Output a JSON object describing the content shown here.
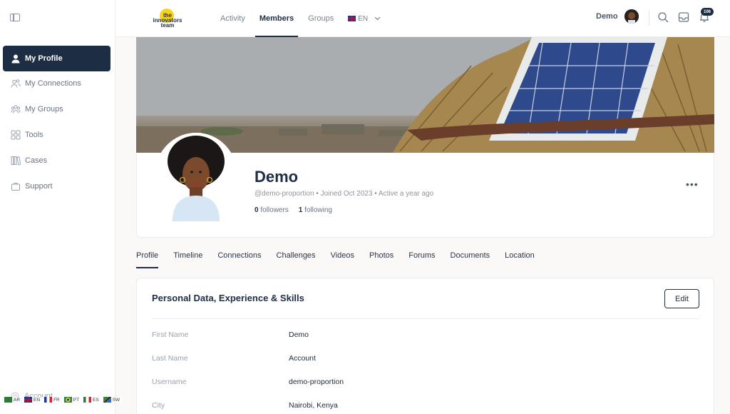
{
  "sidebar": {
    "items": [
      {
        "label": "My Profile",
        "icon": "user-icon"
      },
      {
        "label": "My Connections",
        "icon": "connections-icon"
      },
      {
        "label": "My Groups",
        "icon": "groups-icon"
      },
      {
        "label": "Tools",
        "icon": "tools-icon"
      },
      {
        "label": "Cases",
        "icon": "cases-icon"
      },
      {
        "label": "Support",
        "icon": "support-icon"
      }
    ],
    "account_label": "Account",
    "languages": [
      {
        "code": "AR"
      },
      {
        "code": "EN"
      },
      {
        "code": "FR"
      },
      {
        "code": "PT"
      },
      {
        "code": "ES"
      },
      {
        "code": "SW"
      }
    ]
  },
  "topbar": {
    "logo_text": "the innovators team",
    "nav": [
      {
        "label": "Activity"
      },
      {
        "label": "Members"
      },
      {
        "label": "Groups"
      }
    ],
    "lang_label": "EN",
    "user_name": "Demo",
    "notification_count": "106"
  },
  "profile": {
    "name": "Demo",
    "meta": "@demo-proportion • Joined Oct 2023 • Active a year ago",
    "followers_count": "0",
    "followers_label": "followers",
    "following_count": "1",
    "following_label": "following",
    "more": "•••"
  },
  "tabs": [
    {
      "label": "Profile"
    },
    {
      "label": "Timeline"
    },
    {
      "label": "Connections"
    },
    {
      "label": "Challenges"
    },
    {
      "label": "Videos"
    },
    {
      "label": "Photos"
    },
    {
      "label": "Forums"
    },
    {
      "label": "Documents"
    },
    {
      "label": "Location"
    }
  ],
  "personal": {
    "title": "Personal Data, Experience & Skills",
    "edit_label": "Edit",
    "fields": [
      {
        "label": "First Name",
        "value": "Demo"
      },
      {
        "label": "Last Name",
        "value": "Account"
      },
      {
        "label": "Username",
        "value": "demo-proportion"
      },
      {
        "label": "City",
        "value": "Nairobi, Kenya"
      }
    ]
  },
  "colors": {
    "accent": "#1d2d44",
    "logo_yellow": "#f7d31c"
  }
}
